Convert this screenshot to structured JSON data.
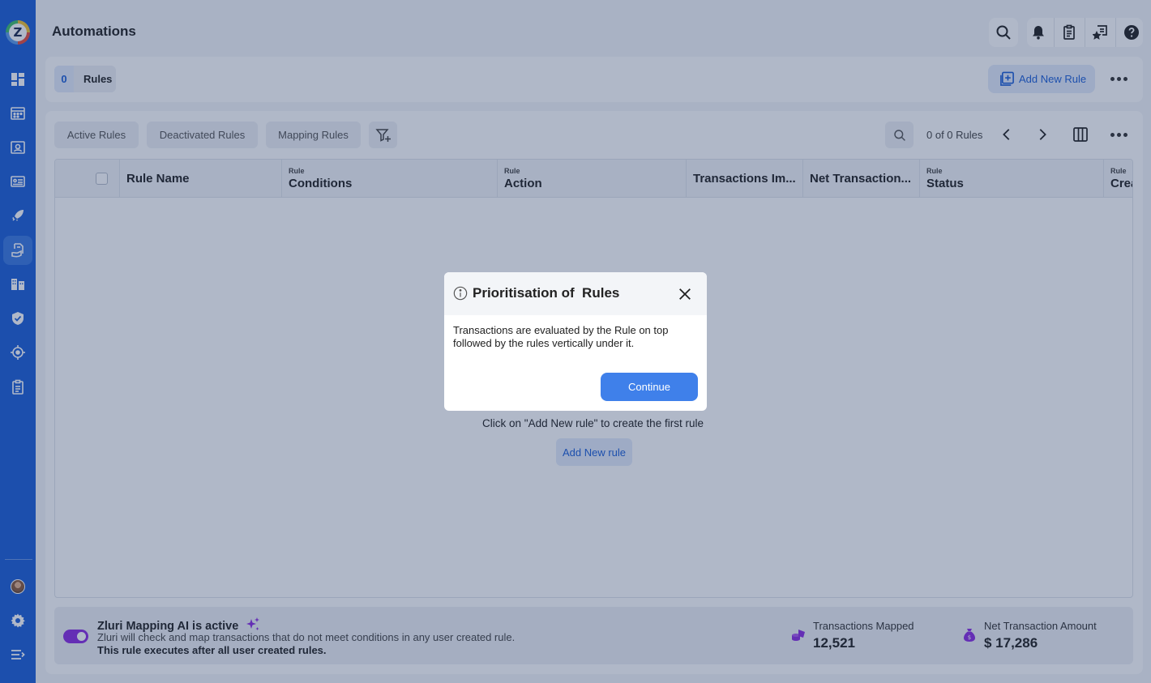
{
  "app": {
    "title": "Automations",
    "logo_letter": "Z"
  },
  "header_icons": [
    "search-icon",
    "bell-icon",
    "clipboard-icon",
    "chat-star-icon",
    "help-icon"
  ],
  "sidebar": {
    "items": [
      {
        "icon": "dashboard-icon"
      },
      {
        "icon": "applications-icon"
      },
      {
        "icon": "users-icon"
      },
      {
        "icon": "departments-icon"
      },
      {
        "icon": "rocket-icon"
      },
      {
        "icon": "transactions-icon",
        "active": true
      },
      {
        "icon": "vendors-icon"
      },
      {
        "icon": "security-icon"
      },
      {
        "icon": "integrations-icon"
      },
      {
        "icon": "reports-icon"
      }
    ],
    "bottom": [
      "avatar",
      "settings-icon",
      "collapse-icon"
    ]
  },
  "rules_bar": {
    "count": "0",
    "label": "Rules",
    "add_button": "Add New Rule"
  },
  "tabs": [
    "Active Rules",
    "Deactivated Rules",
    "Mapping Rules"
  ],
  "pager": {
    "text": "0 of 0 Rules"
  },
  "table": {
    "columns": [
      {
        "sup": "",
        "main": "Rule Name"
      },
      {
        "sup": "Rule",
        "main": "Conditions"
      },
      {
        "sup": "Rule",
        "main": "Action"
      },
      {
        "sup": "",
        "main": "Transactions Im..."
      },
      {
        "sup": "",
        "main": "Net Transaction..."
      },
      {
        "sup": "Rule",
        "main": "Status"
      },
      {
        "sup": "Rule",
        "main": "Crea"
      }
    ],
    "empty_message": "Click on \"Add New rule\" to create the first rule",
    "empty_button": "Add New rule"
  },
  "ai_bar": {
    "title": "Zluri Mapping AI is active",
    "description": "Zluri will check and map transactions that do not meet conditions in any user created rule.",
    "note": "This rule executes after all user created rules.",
    "toggle_on": true,
    "stats": [
      {
        "label": "Transactions Mapped",
        "value": "12,521"
      },
      {
        "label": "Net Transaction Amount",
        "value": "$ 17,286"
      }
    ]
  },
  "modal": {
    "title": "Prioritisation of  Rules",
    "body": "Transactions are evaluated by the Rule on top followed by the rules vertically under it.",
    "button": "Continue"
  },
  "colors": {
    "sidebar": "#1d5fd6",
    "accent": "#3f80ea",
    "toggle": "#8b2be2"
  }
}
